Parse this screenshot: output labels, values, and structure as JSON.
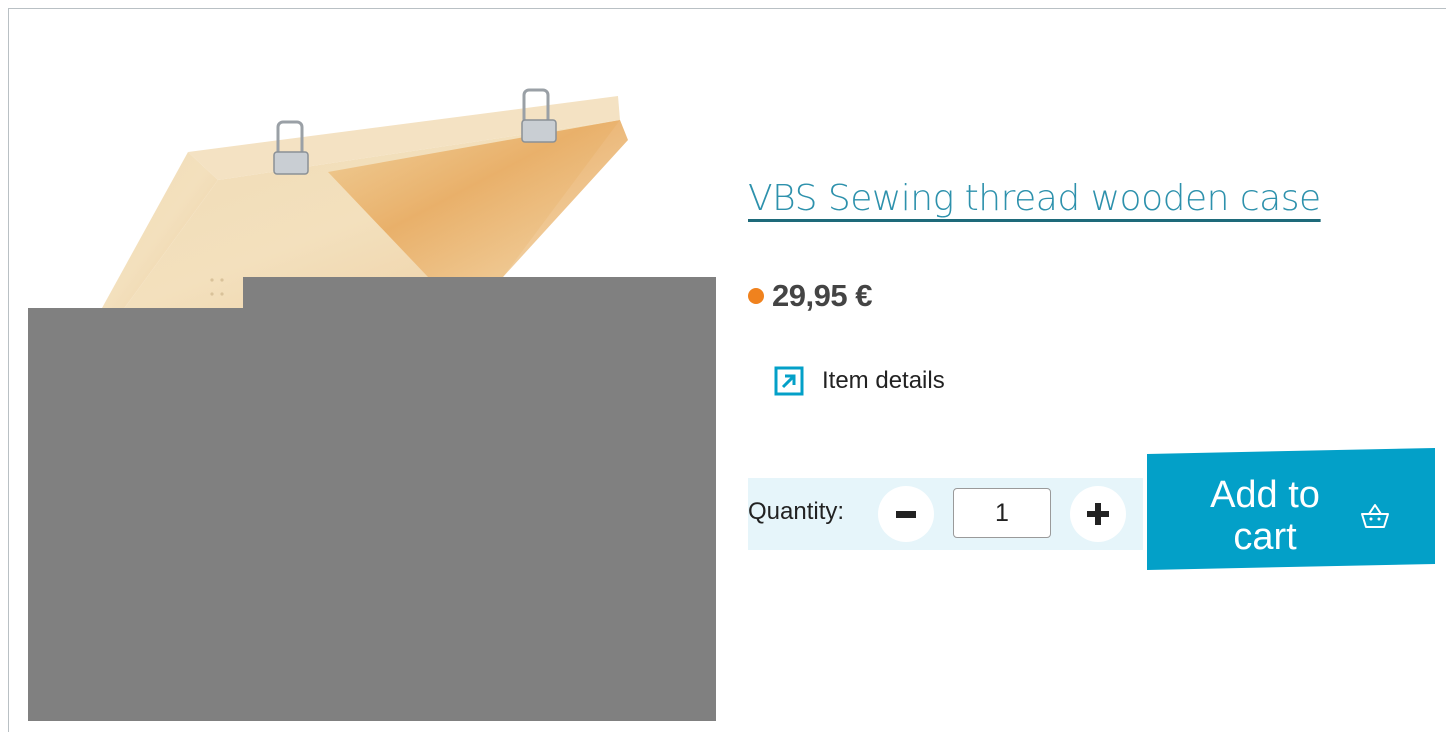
{
  "product": {
    "title": "VBS Sewing thread wooden case",
    "price": "29,95 €",
    "availability_color": "#f0821e",
    "image_alt": "wooden case"
  },
  "details_link": {
    "label": "Item details",
    "icon": "external-arrow-icon"
  },
  "quantity": {
    "label": "Quantity:",
    "value": "1",
    "decrement_icon": "minus-icon",
    "increment_icon": "plus-icon"
  },
  "cart": {
    "label_line1": "Add to",
    "label_line2": "cart",
    "icon": "basket-icon",
    "color": "#03a0c8"
  },
  "colors": {
    "title": "#2d91ac",
    "accent": "#03a0c8",
    "qty_background": "#e6f5fa",
    "placeholder": "#808080"
  }
}
